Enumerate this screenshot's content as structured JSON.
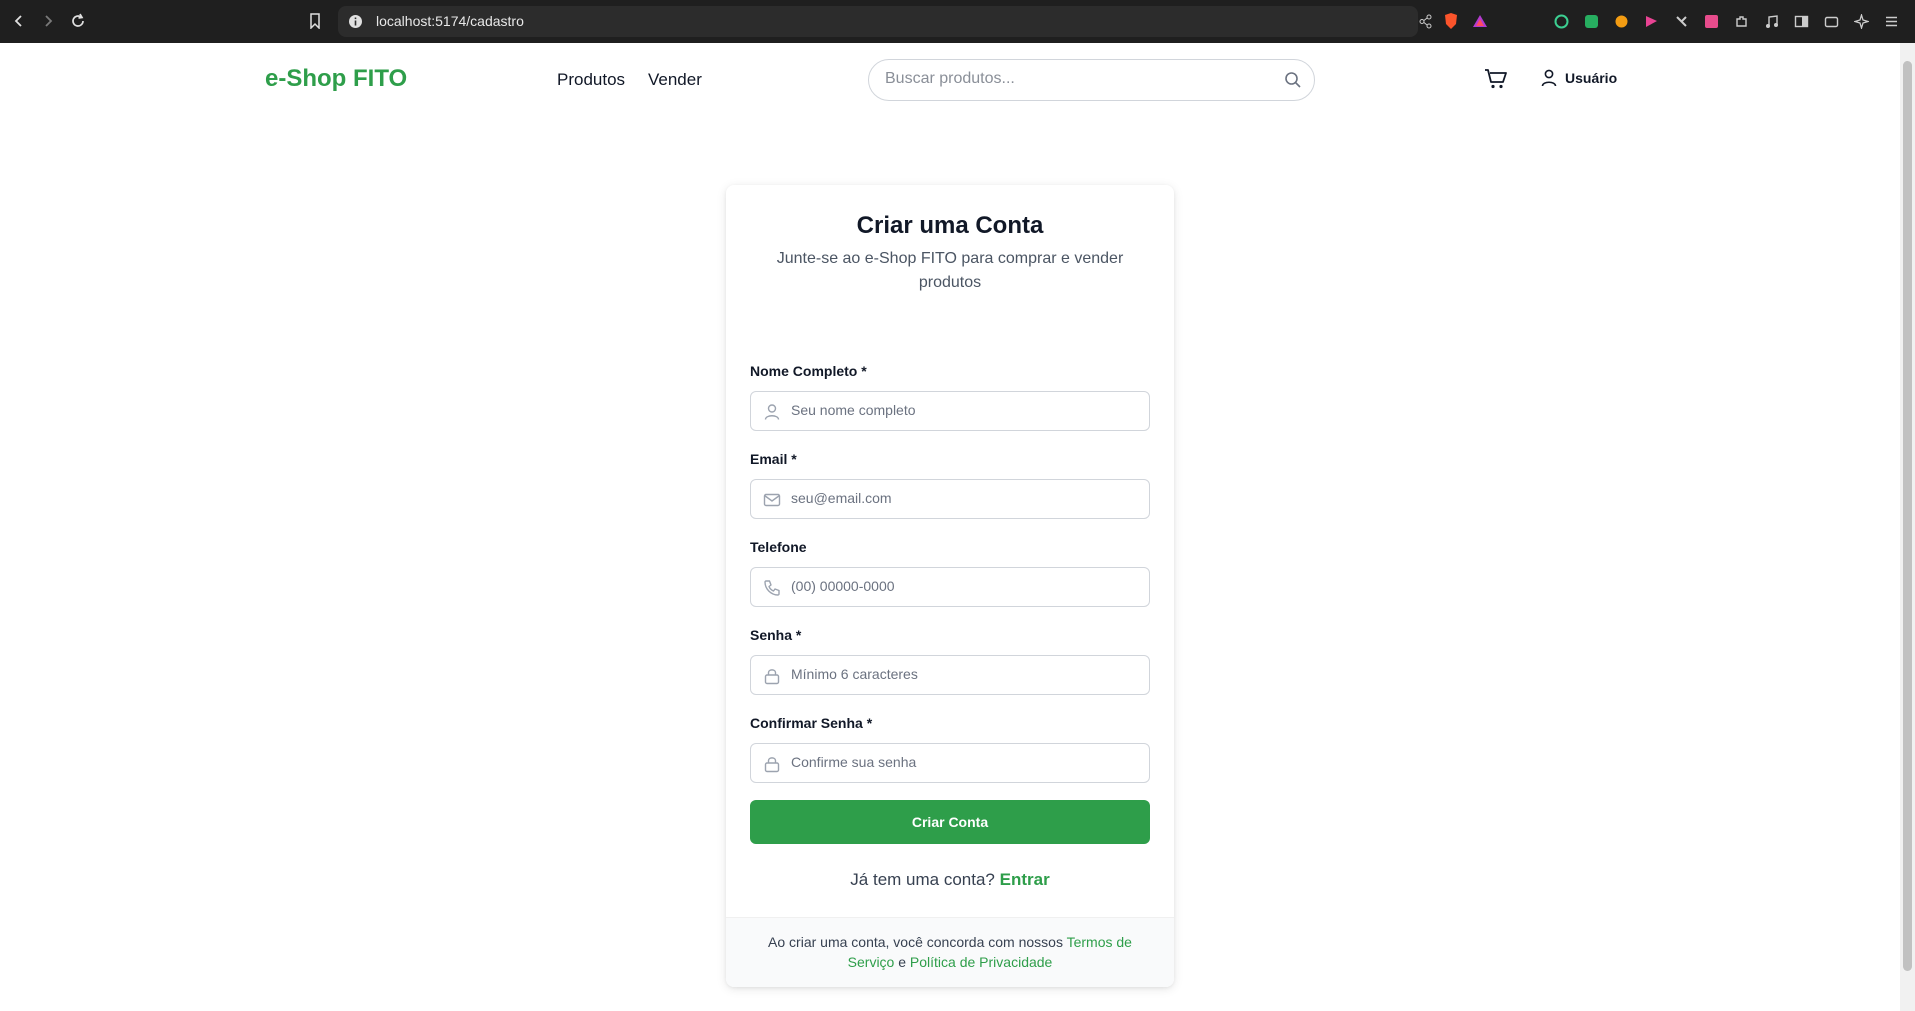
{
  "browser": {
    "url": "localhost:5174/cadastro"
  },
  "header": {
    "logo": "e-Shop FITO",
    "nav": [
      "Produtos",
      "Vender"
    ],
    "search_placeholder": "Buscar produtos...",
    "user_label": "Usuário"
  },
  "card": {
    "title": "Criar uma Conta",
    "subtitle": "Junte-se ao e-Shop FITO para comprar e vender produtos",
    "fields": [
      {
        "label": "Nome Completo *",
        "placeholder": "Seu nome completo",
        "icon": "user-icon"
      },
      {
        "label": "Email *",
        "placeholder": "seu@email.com",
        "icon": "mail-icon"
      },
      {
        "label": "Telefone",
        "placeholder": "(00) 00000-0000",
        "icon": "phone-icon"
      },
      {
        "label": "Senha *",
        "placeholder": "Mínimo 6 caracteres",
        "icon": "lock-icon"
      },
      {
        "label": "Confirmar Senha *",
        "placeholder": "Confirme sua senha",
        "icon": "lock-icon"
      }
    ],
    "submit_label": "Criar Conta",
    "login_prompt": "Já tem uma conta?",
    "login_link": "Entrar",
    "terms_prefix": "Ao criar uma conta, você concorda com nossos",
    "terms_link": "Termos de Serviço",
    "terms_and": "e",
    "privacy_link": "Política de Privacidade"
  },
  "colors": {
    "brand": "#2e9e4a",
    "chrome": "#1f1f1f"
  }
}
